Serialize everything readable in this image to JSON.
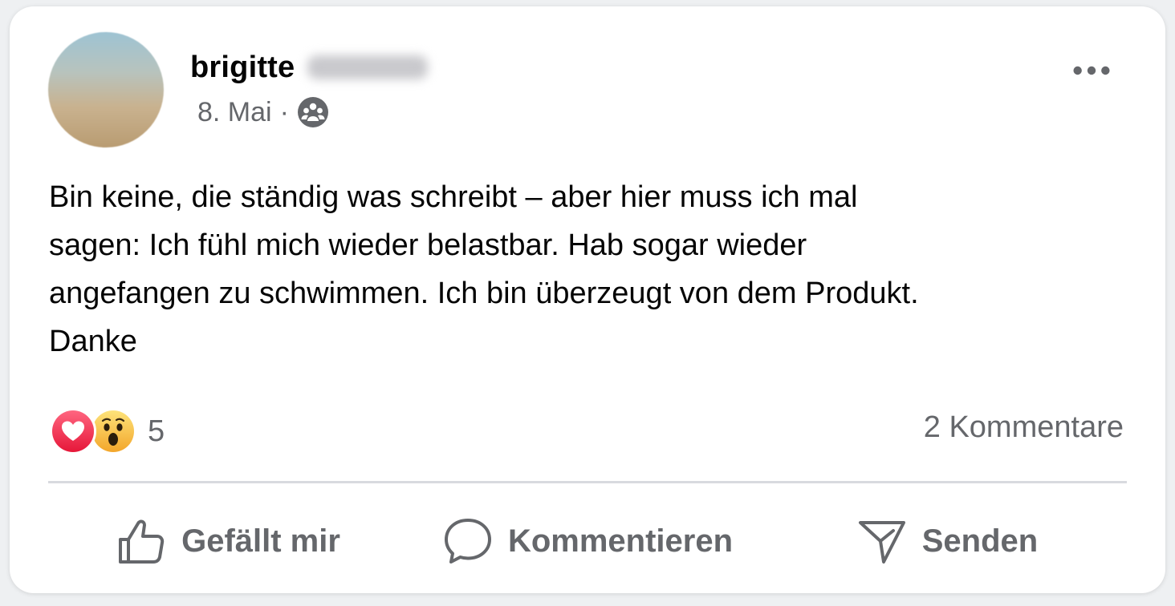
{
  "post": {
    "author_first_name": "brigitte",
    "date": "8. Mai",
    "separator": "·",
    "audience_icon": "group-icon",
    "menu_icon": "more-horizontal-icon",
    "text": "Bin keine, die ständig was schreibt – aber hier muss ich mal\nsagen: Ich fühl mich wieder belastbar. Hab sogar wieder\nangefangen zu schwimmen. Ich bin überzeugt von dem Produkt.\nDanke"
  },
  "engagement": {
    "reactions": [
      {
        "type": "love",
        "icon": "love-reaction-icon",
        "color": "#f33e58"
      },
      {
        "type": "wow",
        "icon": "wow-reaction-icon",
        "color": "#f7b125"
      }
    ],
    "reaction_count": "5",
    "comments_label": "2 Kommentare"
  },
  "actions": {
    "like_label": "Gefällt mir",
    "comment_label": "Kommentieren",
    "send_label": "Senden"
  },
  "colors": {
    "text_primary": "#050505",
    "text_secondary": "#65676b",
    "divider": "#d8dadf"
  }
}
